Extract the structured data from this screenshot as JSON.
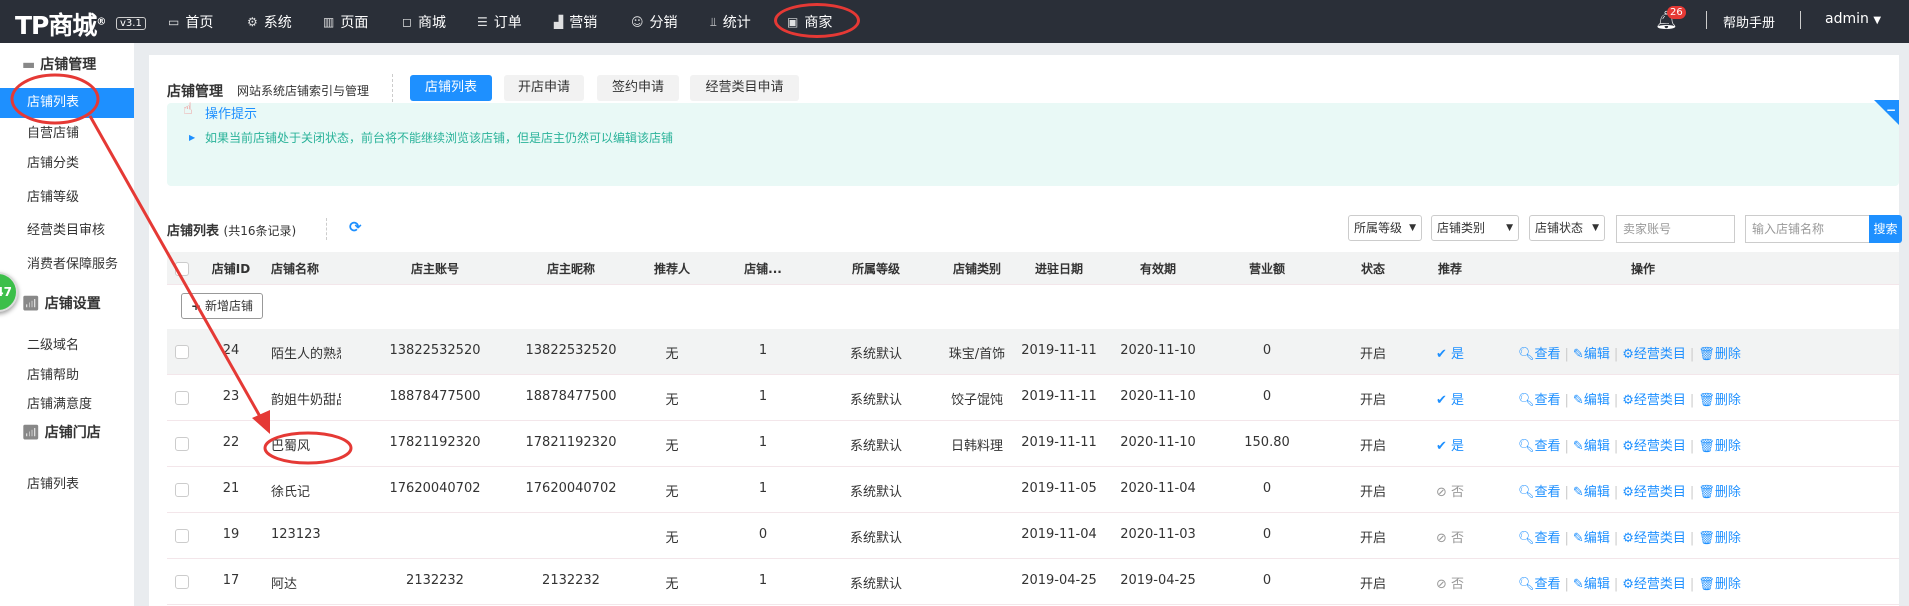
{
  "header": {
    "logo": "TP商城",
    "version": "v3.1",
    "nav": [
      {
        "label": "首页",
        "icon": "monitor-icon"
      },
      {
        "label": "系统",
        "icon": "gear-icon"
      },
      {
        "label": "页面",
        "icon": "page-icon"
      },
      {
        "label": "商城",
        "icon": "bag-icon"
      },
      {
        "label": "订单",
        "icon": "list-icon"
      },
      {
        "label": "营销",
        "icon": "chart-icon"
      },
      {
        "label": "分销",
        "icon": "user-icon"
      },
      {
        "label": "统计",
        "icon": "bar-icon"
      },
      {
        "label": "商家",
        "icon": "store-icon"
      }
    ],
    "notifications": "26",
    "help": "帮助手册",
    "user": "admin"
  },
  "sidebar": {
    "groups": [
      {
        "title": "店铺管理",
        "items": [
          "店铺列表",
          "自营店铺",
          "店铺分类",
          "店铺等级",
          "经营类目审核",
          "消费者保障服务"
        ]
      },
      {
        "title": "店铺设置",
        "items": [
          "二级域名",
          "店铺帮助",
          "店铺满意度"
        ]
      },
      {
        "title": "店铺门店",
        "items": [
          "店铺列表"
        ]
      }
    ],
    "active": "店铺列表",
    "float_badge": "47"
  },
  "page": {
    "title": "店铺管理",
    "subtitle": "网站系统店铺索引与管理",
    "tabs": [
      "店铺列表",
      "开店申请",
      "签约申请",
      "经营类目申请"
    ],
    "tip_title": "操作提示",
    "tip_text": "如果当前店铺处于关闭状态，前台将不能继续浏览该店铺，但是店主仍然可以编辑该店铺",
    "list_title": "店铺列表",
    "list_count": "(共16条记录)",
    "filters": {
      "level": "所属等级",
      "category": "店铺类别",
      "status": "店铺状态",
      "seller_placeholder": "卖家账号",
      "name_placeholder": "输入店铺名称",
      "search": "搜索"
    },
    "add_button": "新增店铺"
  },
  "table": {
    "columns": [
      "店铺ID",
      "店铺名称",
      "店主账号",
      "店主昵称",
      "推荐人",
      "店铺...",
      "所属等级",
      "店铺类别",
      "进驻日期",
      "有效期",
      "营业额",
      "状态",
      "推荐",
      "操作"
    ],
    "actions": [
      "查看",
      "编辑",
      "经营类目",
      "删除"
    ],
    "rows": [
      [
        "24",
        "陌生人的熟悉...",
        "13822532520",
        "13822532520",
        "无",
        "1",
        "系统默认",
        "珠宝/首饰",
        "2019-11-11",
        "2020-11-10",
        "0",
        "开启",
        "是"
      ],
      [
        "23",
        "韵姐牛奶甜品...",
        "18878477500",
        "18878477500",
        "无",
        "1",
        "系统默认",
        "饺子馄饨",
        "2019-11-11",
        "2020-11-10",
        "0",
        "开启",
        "是"
      ],
      [
        "22",
        "巴蜀风",
        "17821192320",
        "17821192320",
        "无",
        "1",
        "系统默认",
        "日韩料理",
        "2019-11-11",
        "2020-11-10",
        "150.80",
        "开启",
        "是"
      ],
      [
        "21",
        "徐氏记",
        "17620040702",
        "17620040702",
        "无",
        "1",
        "系统默认",
        "",
        "2019-11-05",
        "2020-11-04",
        "0",
        "开启",
        "否"
      ],
      [
        "19",
        "123123",
        "",
        "",
        "无",
        "0",
        "系统默认",
        "",
        "2019-11-04",
        "2020-11-03",
        "0",
        "开启",
        "否"
      ],
      [
        "17",
        "阿达",
        "2132232",
        "2132232",
        "无",
        "1",
        "系统默认",
        "",
        "2019-04-25",
        "2019-04-25",
        "0",
        "开启",
        "否"
      ]
    ]
  },
  "colors": {
    "topbar": "#2a2f38",
    "accent": "#1e90ff",
    "tip_bg": "#e9f9f6",
    "annotation": "#e53935"
  }
}
